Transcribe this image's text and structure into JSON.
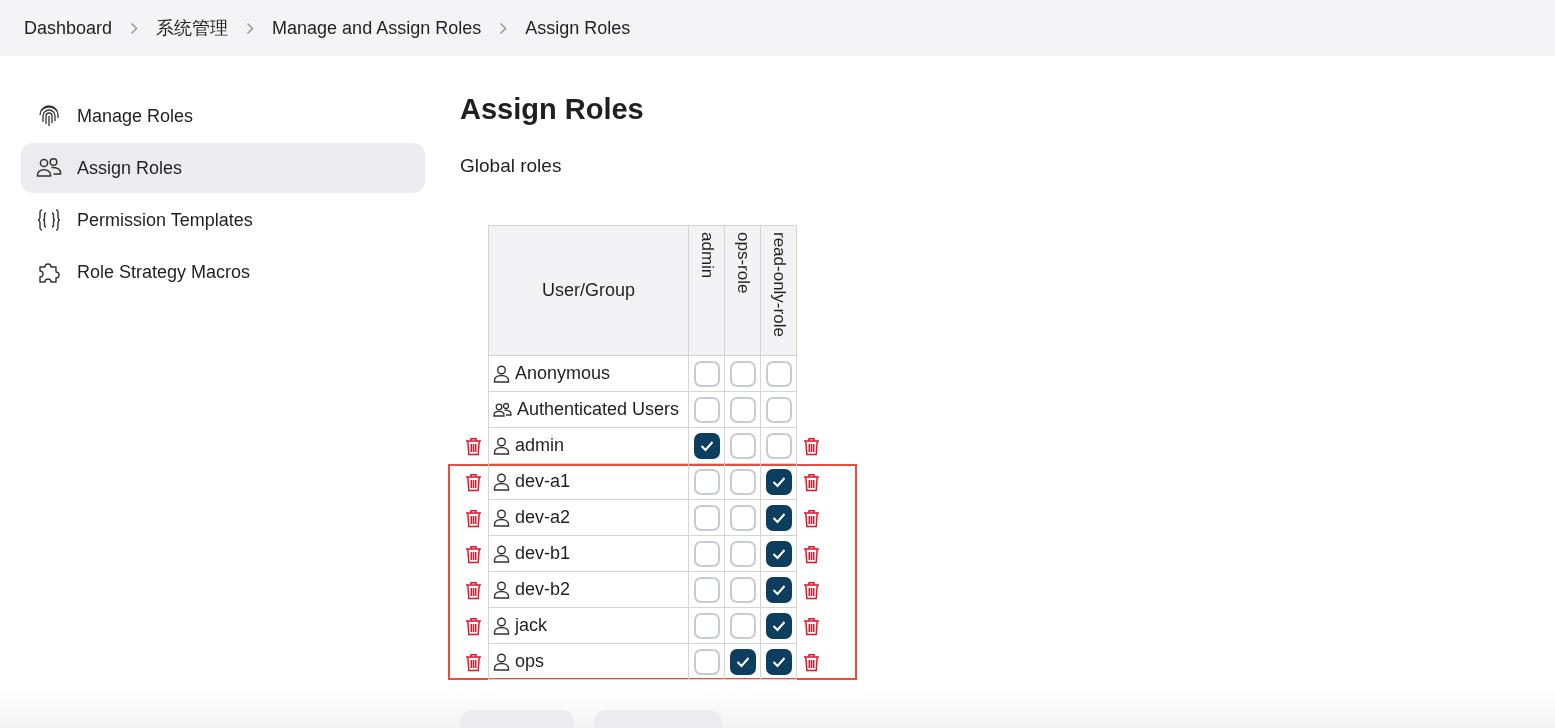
{
  "breadcrumb": [
    {
      "label": "Dashboard"
    },
    {
      "label": "系统管理"
    },
    {
      "label": "Manage and Assign Roles"
    },
    {
      "label": "Assign Roles"
    }
  ],
  "sidebar": {
    "items": [
      {
        "label": "Manage Roles",
        "kind": "fingerprint",
        "selected": false
      },
      {
        "label": "Assign Roles",
        "kind": "people",
        "selected": true
      },
      {
        "label": "Permission Templates",
        "kind": "braces",
        "selected": false
      },
      {
        "label": "Role Strategy Macros",
        "kind": "puzzle",
        "selected": false
      }
    ]
  },
  "page_title": "Assign Roles",
  "section_title": "Global roles",
  "table": {
    "columns": [
      {
        "label": "User/Group"
      },
      {
        "label": "admin"
      },
      {
        "label": "ops-role"
      },
      {
        "label": "read-only-role"
      }
    ],
    "rows": [
      {
        "name": "Anonymous",
        "kind": "user",
        "deletable": false,
        "highlighted": false,
        "roles": [
          {
            "checked": false
          },
          {
            "checked": false
          },
          {
            "checked": false
          }
        ]
      },
      {
        "name": "Authenticated Users",
        "kind": "group",
        "deletable": false,
        "highlighted": false,
        "roles": [
          {
            "checked": false
          },
          {
            "checked": false
          },
          {
            "checked": false
          }
        ]
      },
      {
        "name": "admin",
        "kind": "user",
        "deletable": true,
        "highlighted": false,
        "roles": [
          {
            "checked": true
          },
          {
            "checked": false
          },
          {
            "checked": false
          }
        ]
      },
      {
        "name": "dev-a1",
        "kind": "user",
        "deletable": true,
        "highlighted": true,
        "roles": [
          {
            "checked": false
          },
          {
            "checked": false
          },
          {
            "checked": true
          }
        ]
      },
      {
        "name": "dev-a2",
        "kind": "user",
        "deletable": true,
        "highlighted": true,
        "roles": [
          {
            "checked": false
          },
          {
            "checked": false
          },
          {
            "checked": true
          }
        ]
      },
      {
        "name": "dev-b1",
        "kind": "user",
        "deletable": true,
        "highlighted": true,
        "roles": [
          {
            "checked": false
          },
          {
            "checked": false
          },
          {
            "checked": true
          }
        ]
      },
      {
        "name": "dev-b2",
        "kind": "user",
        "deletable": true,
        "highlighted": true,
        "roles": [
          {
            "checked": false
          },
          {
            "checked": false
          },
          {
            "checked": true
          }
        ]
      },
      {
        "name": "jack",
        "kind": "user",
        "deletable": true,
        "highlighted": true,
        "roles": [
          {
            "checked": false
          },
          {
            "checked": false
          },
          {
            "checked": true
          }
        ]
      },
      {
        "name": "ops",
        "kind": "user",
        "deletable": true,
        "highlighted": true,
        "roles": [
          {
            "checked": false
          },
          {
            "checked": true
          },
          {
            "checked": true
          }
        ]
      }
    ]
  }
}
